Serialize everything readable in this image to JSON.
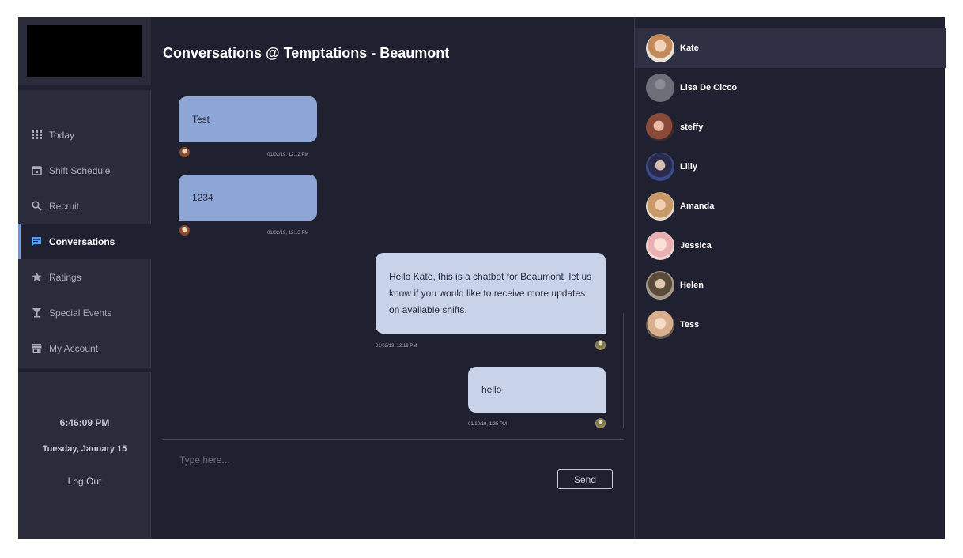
{
  "sidebar": {
    "nav": [
      {
        "label": "Today",
        "icon": "grid-icon",
        "active": false
      },
      {
        "label": "Shift Schedule",
        "icon": "calendar-icon",
        "active": false
      },
      {
        "label": "Recruit",
        "icon": "search-icon",
        "active": false
      },
      {
        "label": "Conversations",
        "icon": "chat-icon",
        "active": true
      },
      {
        "label": "Ratings",
        "icon": "star-icon",
        "active": false
      },
      {
        "label": "Special Events",
        "icon": "cocktail-icon",
        "active": false
      },
      {
        "label": "My Account",
        "icon": "store-icon",
        "active": false
      }
    ],
    "clock": "6:46:09 PM",
    "date": "Tuesday, January 15",
    "logout_label": "Log Out"
  },
  "main": {
    "title": "Conversations @ Temptations - Beaumont",
    "messages": [
      {
        "text": "Test",
        "timestamp": "01/02/19, 12:12 PM",
        "direction": "incoming"
      },
      {
        "text": "1234",
        "timestamp": "01/02/19, 12:13 PM",
        "direction": "incoming"
      },
      {
        "text": "Hello Kate, this is a chatbot for Beaumont, let us know if you would like to receive more updates on available shifts.",
        "timestamp": "01/02/19, 12:19 PM",
        "direction": "outgoing"
      },
      {
        "text": "hello",
        "timestamp": "01/10/19, 1:35 PM",
        "direction": "outgoing"
      }
    ],
    "input_placeholder": "Type here...",
    "send_label": "Send"
  },
  "contacts": [
    {
      "name": "Kate",
      "active": true,
      "color": "#c48a5a"
    },
    {
      "name": "Lisa De Cicco",
      "active": false,
      "color": "#6d6e78"
    },
    {
      "name": "steffy",
      "active": false,
      "color": "#8a4a3a"
    },
    {
      "name": "Lilly",
      "active": false,
      "color": "#3a4a8a"
    },
    {
      "name": "Amanda",
      "active": false,
      "color": "#c89a6a"
    },
    {
      "name": "Jessica",
      "active": false,
      "color": "#e8b0b0"
    },
    {
      "name": "Helen",
      "active": false,
      "color": "#8a7a6a"
    },
    {
      "name": "Tess",
      "active": false,
      "color": "#d8b090"
    }
  ],
  "colors": {
    "accent": "#5b9cf0",
    "bubble_incoming": "#8ea6d6",
    "bubble_outgoing": "#c8d3ea",
    "background": "#202130",
    "sidebar": "#2a2b3b"
  }
}
